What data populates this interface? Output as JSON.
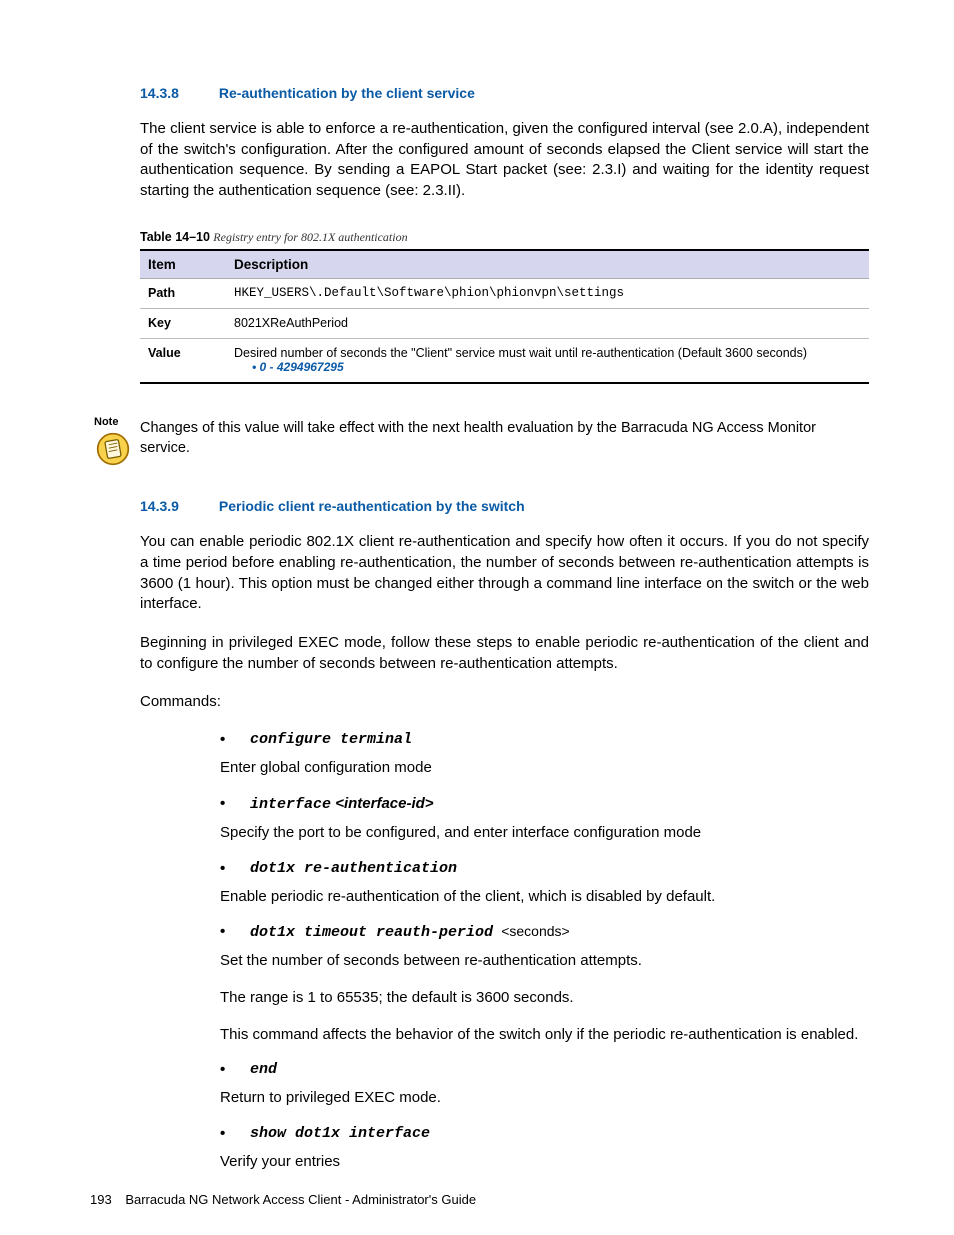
{
  "s1": {
    "num": "14.3.8",
    "title": "Re-authentication by the client service",
    "para": "The client service is able to enforce a re-authentication, given the configured interval (see 2.0.A), independent of the switch's configuration. After the configured amount of seconds elapsed the Client service will start the authentication sequence. By sending a EAPOL Start packet (see: 2.3.I) and waiting for the identity request starting the authentication sequence (see: 2.3.II)."
  },
  "table": {
    "num": "Table 14–10",
    "title": "Registry entry for 802.1X authentication",
    "h1": "Item",
    "h2": "Description",
    "rows": {
      "path_label": "Path",
      "path_value": "HKEY_USERS\\.Default\\Software\\phion\\phionvpn\\settings",
      "key_label": "Key",
      "key_value": "8021XReAuthPeriod",
      "value_label": "Value",
      "value_desc": "Desired number of seconds the \"Client\" service must wait until re-authentication (Default 3600 seconds)",
      "value_range": "0 - 4294967295"
    }
  },
  "note": {
    "label": "Note",
    "text": "Changes of this value will take effect with the next health evaluation by the Barracuda NG Access Monitor service."
  },
  "s2": {
    "num": "14.3.9",
    "title": "Periodic client re-authentication by the switch",
    "para1": "You can enable periodic 802.1X client re-authentication and specify how often it occurs. If you do not specify a time period before enabling re-authentication, the number of seconds between re-authentication attempts is 3600 (1 hour). This option must be changed either through a command line interface on the switch or the web interface.",
    "para2": "Beginning in privileged EXEC mode, follow these steps to enable periodic re-authentication of the client and to configure the number of seconds between re-authentication attempts.",
    "commands_label": "Commands:"
  },
  "cmds": {
    "c1": "configure terminal",
    "d1": "Enter global configuration mode",
    "c2": "interface",
    "c2arg": "<interface-id>",
    "d2": "Specify the port to be configured, and enter interface configuration mode",
    "c3": "dot1x re-authentication",
    "d3": "Enable periodic re-authentication of the client, which is disabled by default.",
    "c4": "dot1x timeout reauth-period",
    "c4arg": "<seconds>",
    "d4a": "Set the number of seconds between re-authentication attempts.",
    "d4b": "The range is 1 to 65535; the default is 3600 seconds.",
    "d4c": "This command affects the behavior of the switch only if the periodic re-authentication is enabled.",
    "c5": "end",
    "d5": "Return to privileged EXEC mode.",
    "c6": "show dot1x interface",
    "d6": "Verify your entries"
  },
  "footer": {
    "page": "193",
    "title": "Barracuda NG Network Access Client - Administrator's Guide"
  }
}
